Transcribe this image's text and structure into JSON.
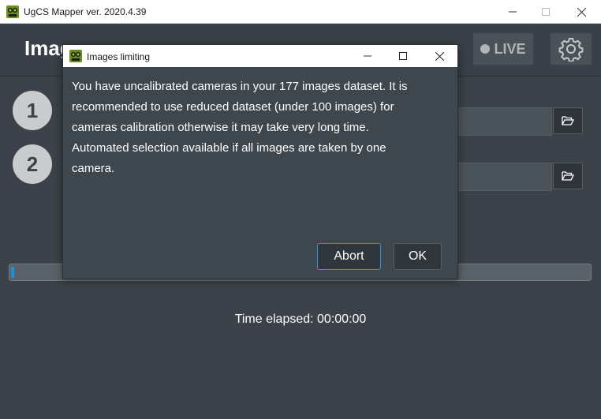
{
  "window": {
    "title": "UgCS Mapper ver. 2020.4.39",
    "controls": [
      "minimize",
      "maximize",
      "close"
    ]
  },
  "header": {
    "page_title": "Imag",
    "live_label": "LIVE"
  },
  "steps": [
    {
      "number": "1"
    },
    {
      "number": "2"
    }
  ],
  "progress": {
    "value_percent": 0.5
  },
  "status": {
    "elapsed_label": "Time elapsed: 00:00:00"
  },
  "dialog": {
    "title": "Images limiting",
    "message_lines": [
      "You have uncalibrated cameras in your 177 images dataset. It is",
      "recommended to use reduced dataset (under 100 images) for",
      "cameras calibration otherwise it may take very long time.",
      "Automated selection available if all images are taken by one",
      "camera."
    ],
    "buttons": {
      "abort": "Abort",
      "ok": "OK"
    }
  },
  "colors": {
    "accent": "#1e90d8",
    "background": "#3b4249",
    "dialog_bg": "#3f474e"
  }
}
